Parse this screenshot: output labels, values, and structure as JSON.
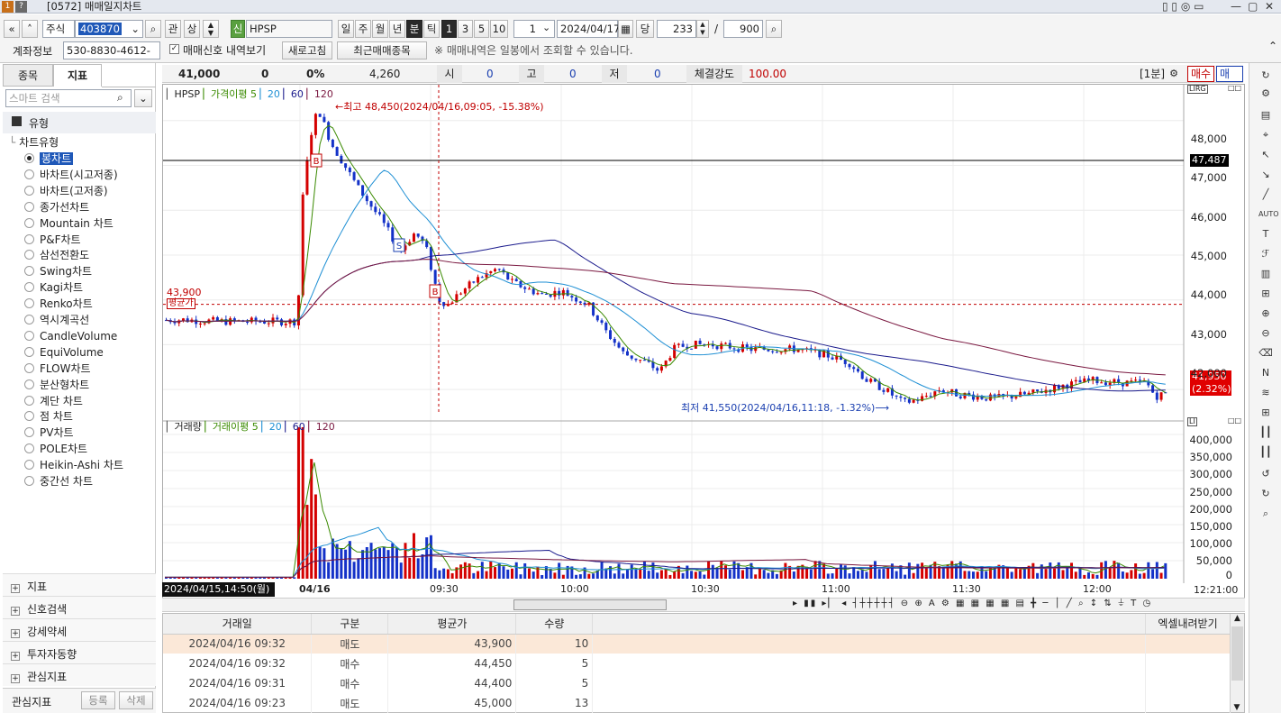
{
  "titlebar": {
    "title": "[0572] 매매일지차트"
  },
  "toolbar": {
    "market_type": "주식",
    "code": "403870",
    "btn_watch": "관",
    "btn_up": "상",
    "btn_signal": "신",
    "name": "HPSP",
    "periods": [
      "일",
      "주",
      "월",
      "년",
      "분",
      "틱"
    ],
    "intervals": [
      "1",
      "3",
      "5",
      "10"
    ],
    "interval_value": "1",
    "date": "2024/04/17",
    "btn_today": "당",
    "count_a": "233",
    "slash": "/",
    "count_b": "900"
  },
  "toolbar2": {
    "account_label": "계좌정보",
    "account_value": "530-8830-4612-",
    "signal_check": "매매신호 내역보기",
    "refresh_button": "새로고침",
    "recent_button": "최근매매종목",
    "notice": "※ 매매내역은 일봉에서 조회할 수 있습니다."
  },
  "left": {
    "tabs": [
      "종목",
      "지표"
    ],
    "search_placeholder": "스마트 검색",
    "group_label": "유형",
    "subgroup_label": "차트유형",
    "items": [
      "봉차트",
      "바차트(시고저종)",
      "바차트(고저종)",
      "종가선차트",
      "Mountain 차트",
      "P&F차트",
      "삼선전환도",
      "Swing차트",
      "Kagi차트",
      "Renko차트",
      "역시계곡선",
      "CandleVolume",
      "EquiVolume",
      "FLOW차트",
      "분산형차트",
      "계단 차트",
      "점 차트",
      "PV차트",
      "POLE차트",
      "Heikin-Ashi 차트",
      "중간선 차트"
    ],
    "bottom_groups": [
      "지표",
      "신호검색",
      "강세약세",
      "투자자동향",
      "관심지표"
    ],
    "fav_label": "관심지표",
    "btn_register": "등록",
    "btn_delete": "삭제"
  },
  "status": {
    "price": "41,000",
    "change": "0",
    "rate": "0%",
    "volume": "4,260",
    "open_label": "시",
    "open": "0",
    "high_label": "고",
    "high": "0",
    "low_label": "저",
    "low": "0",
    "strength_label": "체결강도",
    "strength": "100.00",
    "period_label": "[1분]",
    "buy_label": "매수",
    "sell_label": "매도"
  },
  "price_chart": {
    "legend_name": "HPSP",
    "legend_ma": "가격이평",
    "ma_periods": [
      "5",
      "20",
      "60",
      "120"
    ],
    "high_annot": "←최고 48,450(2024/04/16,09:05, -15.38%)",
    "low_annot": "최저 41,550(2024/04/16,11:18, -1.32%)⟶",
    "avg_label": "43,900",
    "avg_tag": "평균가",
    "cursor_price": "47,487",
    "last_price": "41,950",
    "last_rate": "(2.32%)",
    "y_ticks": [
      "48,000",
      "47,000",
      "46,000",
      "45,000",
      "44,000",
      "43,000",
      "42,000"
    ],
    "signals": [
      "B",
      "S",
      "B"
    ]
  },
  "volume_chart": {
    "legend_name": "거래량",
    "legend_ma": "거래이평",
    "ma_periods": [
      "5",
      "20",
      "60",
      "120"
    ],
    "y_ticks": [
      "400,000",
      "350,000",
      "300,000",
      "250,000",
      "200,000",
      "150,000",
      "100,000",
      "50,000",
      "0"
    ]
  },
  "x_axis": {
    "start": "2024/04/15,14:50(월)",
    "labels": [
      "04/16",
      "09:30",
      "10:00",
      "10:30",
      "11:00",
      "11:30",
      "12:00"
    ],
    "end": "12:21:00"
  },
  "chart_data": {
    "type": "candlestick",
    "title": "HPSP",
    "ylabel": "",
    "ylim": [
      41400,
      48800
    ],
    "high": 48450,
    "low": 41550,
    "current": 41950,
    "avg_price": 43900,
    "series": [
      {
        "name": "가격이평 5"
      },
      {
        "name": "20"
      },
      {
        "name": "60"
      },
      {
        "name": "120"
      }
    ],
    "volume_ylim": [
      0,
      420000
    ]
  },
  "trades": {
    "headers": [
      "거래일",
      "구분",
      "평균가",
      "수량",
      "엑셀내려받기"
    ],
    "rows": [
      {
        "date": "2024/04/16  09:32",
        "side": "매도",
        "price": "43,900",
        "qty": "10"
      },
      {
        "date": "2024/04/16  09:32",
        "side": "매수",
        "price": "44,450",
        "qty": "5"
      },
      {
        "date": "2024/04/16  09:31",
        "side": "매수",
        "price": "44,400",
        "qty": "5"
      },
      {
        "date": "2024/04/16  09:23",
        "side": "매도",
        "price": "45,000",
        "qty": "13"
      }
    ]
  },
  "colors": {
    "up": "#d40000",
    "down": "#1432c8",
    "ma5": "#3a8a00",
    "ma20": "#1e8fd4",
    "ma60": "#1a1a8c",
    "ma120": "#7a1840"
  }
}
